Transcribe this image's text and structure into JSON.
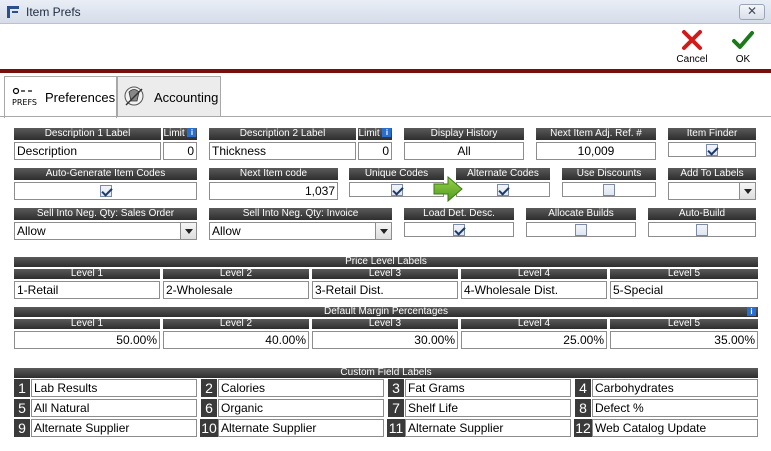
{
  "window": {
    "title": "Item Prefs",
    "close_label": "✕"
  },
  "toolbar": {
    "cancel_label": "Cancel",
    "ok_label": "OK"
  },
  "tabs": [
    {
      "label": "Preferences",
      "icon_text": "PREFS"
    },
    {
      "label": "Accounting"
    }
  ],
  "fields": {
    "desc1": {
      "label": "Description 1 Label",
      "value": "Description",
      "limit_label": "Limit",
      "limit": "0"
    },
    "desc2": {
      "label": "Description 2 Label",
      "value": "Thickness",
      "limit_label": "Limit",
      "limit": "0"
    },
    "display_history": {
      "label": "Display History",
      "value": "All"
    },
    "next_adj": {
      "label": "Next Item Adj. Ref. #",
      "value": "10,009"
    },
    "item_finder": {
      "label": "Item Finder",
      "checked": true
    },
    "auto_gen": {
      "label": "Auto-Generate Item Codes",
      "checked": true
    },
    "next_item_code": {
      "label": "Next Item code",
      "value": "1,037"
    },
    "unique_codes": {
      "label": "Unique Codes",
      "checked": true
    },
    "alternate_codes": {
      "label": "Alternate Codes",
      "checked": true
    },
    "use_discounts": {
      "label": "Use Discounts",
      "checked": false
    },
    "add_to_labels": {
      "label": "Add To Labels",
      "value": ""
    },
    "sell_neg_so": {
      "label": "Sell Into Neg. Qty: Sales Order",
      "value": "Allow"
    },
    "sell_neg_inv": {
      "label": "Sell Into Neg. Qty: Invoice",
      "value": "Allow"
    },
    "load_det_desc": {
      "label": "Load Det. Desc.",
      "checked": true
    },
    "allocate_builds": {
      "label": "Allocate Builds",
      "checked": false
    },
    "auto_build": {
      "label": "Auto-Build",
      "checked": false
    }
  },
  "price_levels": {
    "title": "Price Level Labels",
    "headers": [
      "Level 1",
      "Level 2",
      "Level 3",
      "Level 4",
      "Level 5"
    ],
    "values": [
      "1-Retail",
      "2-Wholesale",
      "3-Retail Dist.",
      "4-Wholesale Dist.",
      "5-Special"
    ]
  },
  "margins": {
    "title": "Default Margin Percentages",
    "headers": [
      "Level 1",
      "Level 2",
      "Level 3",
      "Level 4",
      "Level 5"
    ],
    "values": [
      "50.00%",
      "40.00%",
      "30.00%",
      "25.00%",
      "35.00%"
    ]
  },
  "custom_fields": {
    "title": "Custom Field Labels",
    "items": [
      {
        "num": "1",
        "value": "Lab Results"
      },
      {
        "num": "2",
        "value": "Calories"
      },
      {
        "num": "3",
        "value": "Fat Grams"
      },
      {
        "num": "4",
        "value": "Carbohydrates"
      },
      {
        "num": "5",
        "value": "All Natural"
      },
      {
        "num": "6",
        "value": "Organic"
      },
      {
        "num": "7",
        "value": "Shelf Life"
      },
      {
        "num": "8",
        "value": "Defect %"
      },
      {
        "num": "9",
        "value": "Alternate Supplier"
      },
      {
        "num": "10",
        "value": "Alternate Supplier"
      },
      {
        "num": "11",
        "value": "Alternate Supplier"
      },
      {
        "num": "12",
        "value": "Web Catalog Update"
      }
    ]
  },
  "colors": {
    "accent_line": "#7a0d0d",
    "header_bg": "#3a3a3a",
    "cancel_red": "#d21a1a",
    "ok_green": "#1a7a1a"
  },
  "icons": {
    "cancel": "red-x-icon",
    "ok": "green-check-icon",
    "arrow": "green-arrow-icon"
  }
}
